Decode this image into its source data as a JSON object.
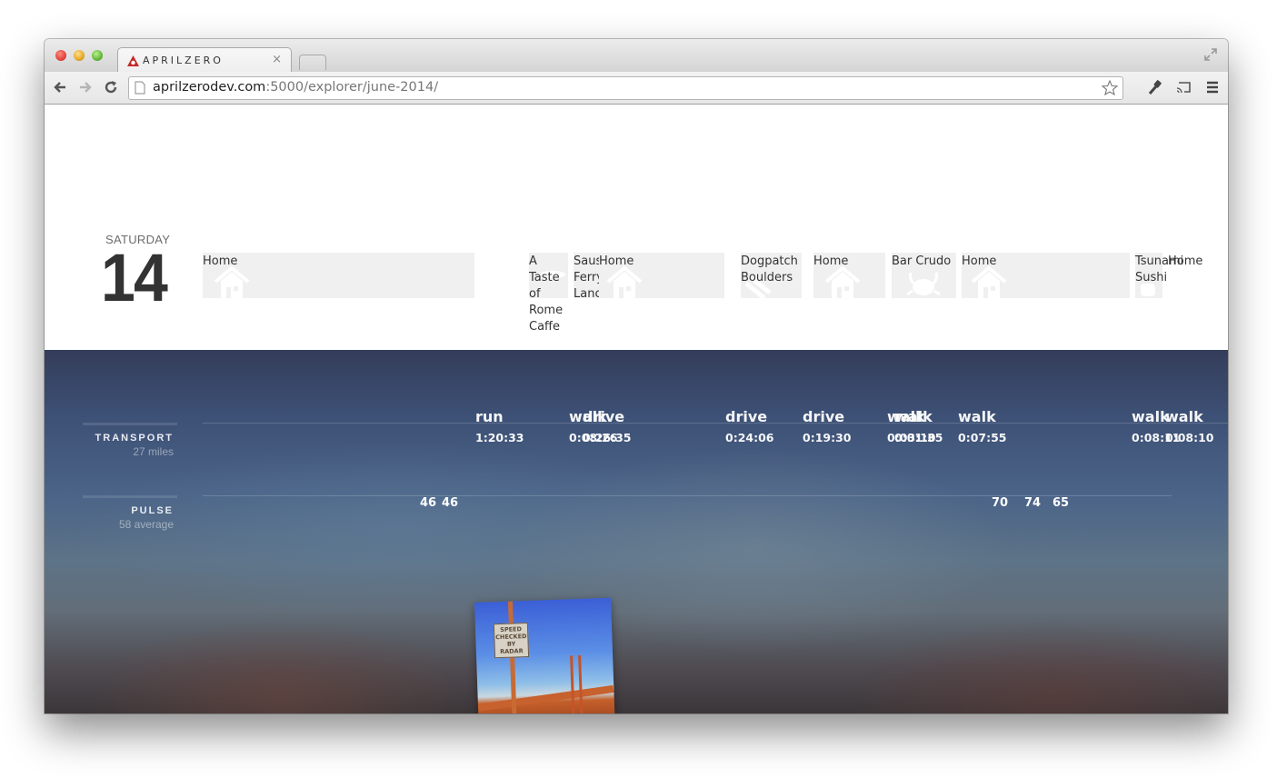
{
  "browser": {
    "tab_title": "APRILZERO",
    "tab_close": "×",
    "url_host": "aprilzerodev.com",
    "url_rest": ":5000/explorer/june-2014/",
    "icons": [
      "back-arrow-icon",
      "forward-arrow-icon",
      "reload-icon",
      "page-icon",
      "star-icon",
      "wrench-icon",
      "cast-icon",
      "menu-icon",
      "fullscreen-icon"
    ]
  },
  "day": {
    "weekday": "SATURDAY",
    "date": "14"
  },
  "places": [
    {
      "name": "Home",
      "icon": "house-icon"
    },
    {
      "name": "A Taste of Rome Caffe",
      "icon": "cup-icon"
    },
    {
      "name": "Sausalito Ferry Landing",
      "icon": "ferry-icon"
    },
    {
      "name": "Home",
      "icon": "house-icon"
    },
    {
      "name": "Dogpatch Boulders",
      "icon": "climbing-icon"
    },
    {
      "name": "Home",
      "icon": "house-icon"
    },
    {
      "name": "Bar Crudo",
      "icon": "crab-icon"
    },
    {
      "name": "Home",
      "icon": "house-icon"
    },
    {
      "name": "Tsunami Sushi",
      "icon": "sushi-icon"
    },
    {
      "name": "Home",
      "icon": "house-icon"
    }
  ],
  "transport": {
    "title": "TRANSPORT",
    "subtitle": "27 miles",
    "trips": [
      {
        "mode": "run",
        "duration": "1:20:33"
      },
      {
        "mode": "walk",
        "duration": "0:08:26"
      },
      {
        "mode": "drive",
        "duration": "0:26:35"
      },
      {
        "mode": "drive",
        "duration": "0:24:06"
      },
      {
        "mode": "drive",
        "duration": "0:19:30"
      },
      {
        "mode": "walk",
        "duration": "0:03:10"
      },
      {
        "mode": "walk",
        "duration": "0:01:35"
      },
      {
        "mode": "walk",
        "duration": "0:07:55"
      },
      {
        "mode": "walk",
        "duration": "0:08:11"
      },
      {
        "mode": "walk",
        "duration": "0:08:10"
      }
    ]
  },
  "pulse": {
    "title": "PULSE",
    "subtitle": "58 average",
    "readings": [
      "46",
      "46",
      "70",
      "74",
      "65"
    ]
  },
  "photo": {
    "sign_text": "SPEED CHECKED BY RADAR",
    "description": "Golden Gate Bridge with speed sign"
  }
}
